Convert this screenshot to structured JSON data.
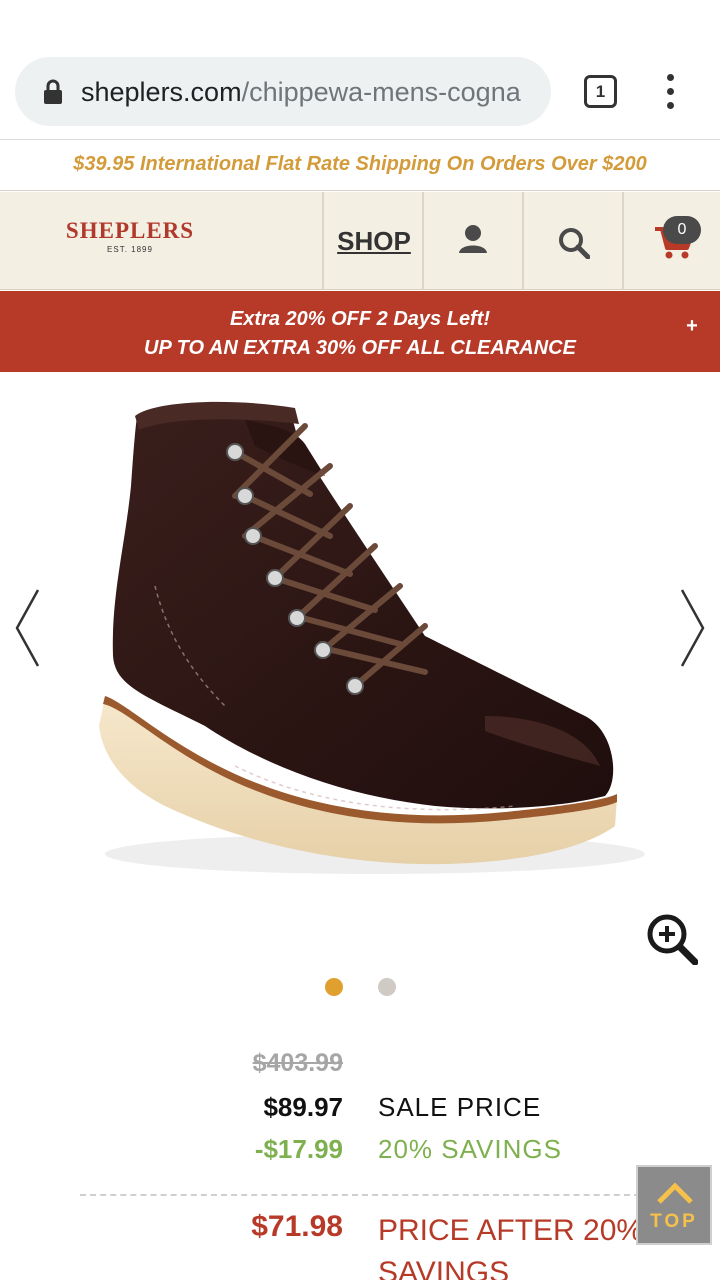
{
  "browser": {
    "url_host": "sheplers.com",
    "url_path": "/chippewa-mens-cogna",
    "tab_count": "1",
    "icons": [
      "lock-icon",
      "tabs-icon",
      "more-menu-icon"
    ]
  },
  "shipping_banner": {
    "text": "$39.95 International Flat Rate Shipping On Orders Over $200",
    "color": "#d49b3a"
  },
  "header": {
    "logo_name": "SHEPLERS",
    "logo_est": "EST. 1899",
    "shop_label": "SHOP",
    "cart_count": "0",
    "icons": [
      "account-icon",
      "search-icon",
      "cart-icon"
    ],
    "brand_color": "#b0392b"
  },
  "promo": {
    "line1": "Extra 20% OFF 2 Days Left!",
    "line2": "UP TO AN EXTRA 30% OFF ALL CLEARANCE",
    "expand_symbol": "+",
    "background": "#b73a28"
  },
  "gallery": {
    "image": "dark-brown-leather-lace-up-boot",
    "slide_count": 2,
    "active_slide": 1,
    "active_dot_color": "#e0a030",
    "inactive_dot_color": "#cfcac4",
    "icons": [
      "chevron-left-icon",
      "chevron-right-icon",
      "zoom-in-icon"
    ]
  },
  "pricing": {
    "original_price": "$403.99",
    "sale_price": "$89.97",
    "sale_label": "SALE PRICE",
    "savings_amount": "-$17.99",
    "savings_label": "20% SAVINGS",
    "final_price": "$71.98",
    "final_label": "PRICE AFTER 20% SAVINGS"
  },
  "back_to_top": {
    "label": "TOP"
  }
}
